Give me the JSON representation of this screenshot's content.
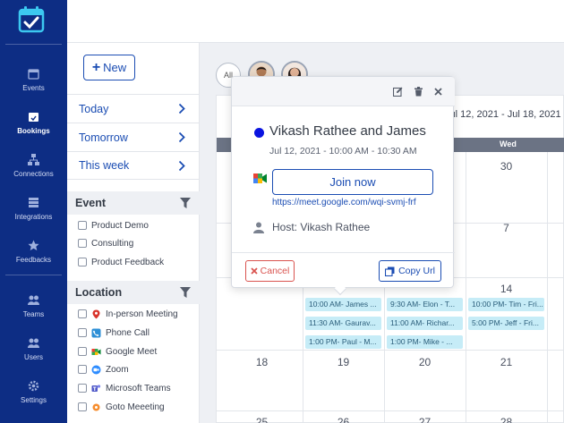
{
  "nav": {
    "items": [
      {
        "label": "Events",
        "icon": "calendar-icon"
      },
      {
        "label": "Bookings",
        "icon": "bookings-icon"
      },
      {
        "label": "Connections",
        "icon": "connections-icon"
      },
      {
        "label": "Integrations",
        "icon": "integrations-icon"
      },
      {
        "label": "Feedbacks",
        "icon": "star-icon"
      },
      {
        "label": "Teams",
        "icon": "team-icon"
      },
      {
        "label": "Users",
        "icon": "users-icon"
      },
      {
        "label": "Settings",
        "icon": "gear-icon"
      }
    ]
  },
  "sidebar": {
    "new_label": "New",
    "quick": [
      "Today",
      "Tomorrow",
      "This week"
    ],
    "event_header": "Event",
    "event_filters": [
      "Product Demo",
      "Consulting",
      "Product Feedback"
    ],
    "location_header": "Location",
    "location_filters": [
      "In-person Meeting",
      "Phone Call",
      "Google Meet",
      "Zoom",
      "Microsoft Teams",
      "Goto Meeeting"
    ]
  },
  "calendar": {
    "avatar_all": "All",
    "date_range": "Jul 12, 2021 - Jul 18, 2021",
    "dow": [
      "Wed"
    ],
    "days_row1": [
      "30"
    ],
    "days_row2": [
      "7"
    ],
    "days_row3": [
      "14"
    ],
    "days_row4": [
      "18",
      "19",
      "20",
      "21"
    ],
    "days_row5": [
      "25",
      "26",
      "27",
      "28"
    ],
    "events_col1": [
      "10:00 AM- James ...",
      "11:30 AM- Gaurav...",
      "1:00 PM- Paul - M..."
    ],
    "events_col2": [
      "9:30 AM- Elon - T...",
      "11:00 AM- Richar...",
      "1:00 PM- Mike - ..."
    ],
    "events_col3": [
      "10:00 PM- Tim - Fri...",
      "5:00 PM- Jeff - Fri..."
    ]
  },
  "popup": {
    "title": "Vikash Rathee and James",
    "time": "Jul 12, 2021 - 10:00 AM - 10:30 AM",
    "join_label": "Join now",
    "link": "https://meet.google.com/wqi-svmj-frf",
    "host": "Host: Vikash Rathee",
    "cancel_label": "Cancel",
    "copy_label": "Copy Url",
    "color": "#0a14e0"
  },
  "colors": {
    "nav": "#0d2d84",
    "accent": "#1b4db3",
    "event_chip": "#c6ecf7",
    "danger": "#d9534f"
  }
}
